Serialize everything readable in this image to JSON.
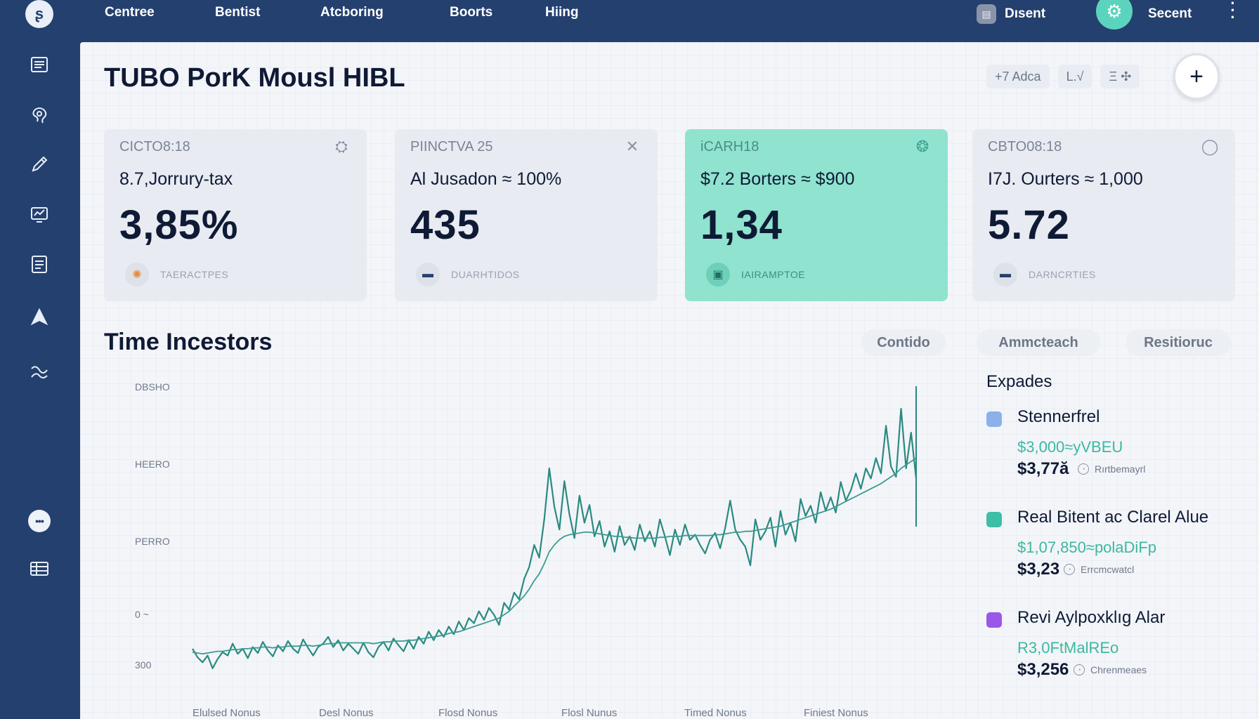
{
  "colors": {
    "nav_bg": "#24406f",
    "accent": "#5cd4bd",
    "chart_line": "#2a8a80",
    "active_card": "#8fe3cf"
  },
  "topbar": {
    "logo_icon": "swirl-logo-icon",
    "nav": [
      "Centree",
      "Bentist",
      "Atcboring",
      "Boorts",
      "Hiing"
    ],
    "doc_label": "Dısent",
    "user_label": "Secent"
  },
  "sidebar": {
    "icons": [
      "list-icon",
      "brain-icon",
      "pencil-icon",
      "monitor-chart-icon",
      "document-icon",
      "paper-plane-icon",
      "exchange-icon",
      "more-dots-icon",
      "grid-list-icon"
    ]
  },
  "page": {
    "title": "TUBO PorK Mousl HIBL",
    "toolbar": [
      "+7 Adca",
      "L.√",
      "Ξ ✣"
    ]
  },
  "kpis": [
    {
      "code": "CICTO8:18",
      "subtitle": "8.7,Jorrury-tax",
      "value": "3,85%",
      "footer": "TAERACTPES",
      "active": false
    },
    {
      "code": "PIINCTVA 25",
      "subtitle": "Al Jusadon ≈ 100%",
      "value": "435",
      "footer": "DUARHTIDOS",
      "active": false
    },
    {
      "code": "iCARH18",
      "subtitle": "$7.2 Borters ≈ $900",
      "value": "1,34",
      "footer": "IAIRAMPTOE",
      "active": true
    },
    {
      "code": "CBTO08:18",
      "subtitle": "I7J. Ourters ≈ 1,000",
      "value": "5.72",
      "footer": "DARNCRTIES",
      "active": false
    }
  ],
  "section": {
    "title": "Time Incestors",
    "pills": [
      "Contido",
      "Ammcteach",
      "Resitioruc"
    ]
  },
  "chart_data": {
    "type": "line",
    "ytick_labels": [
      "DBSHO",
      "HEERO",
      "PERRO",
      "0 ~",
      "300"
    ],
    "xtick_labels": [
      "Elulsed Nonus",
      "Desl Nonus",
      "Flosd Nonus",
      "Flosl Nunus",
      "Timed Nonus",
      "Finiest Nonus"
    ],
    "series": [
      {
        "values": [
          38,
          28,
          22,
          30,
          15,
          26,
          34,
          30,
          44,
          32,
          38,
          27,
          40,
          33,
          46,
          36,
          29,
          42,
          35,
          47,
          38,
          33,
          49,
          39,
          30,
          40,
          44,
          52,
          40,
          48,
          36,
          44,
          38,
          32,
          45,
          34,
          28,
          40,
          46,
          36,
          50,
          42,
          35,
          48,
          38,
          52,
          44,
          58,
          48,
          60,
          52,
          64,
          55,
          70,
          60,
          74,
          68,
          82,
          72,
          86,
          78,
          66,
          92,
          84,
          104,
          96,
          120,
          134,
          160,
          145,
          190,
          250,
          205,
          178,
          235,
          196,
          168,
          218,
          186,
          207,
          170,
          188,
          158,
          176,
          152,
          182,
          160,
          170,
          154,
          184,
          164,
          176,
          158,
          190,
          170,
          148,
          178,
          160,
          184,
          166,
          172,
          160,
          150,
          166,
          174,
          156,
          180,
          212,
          178,
          166,
          158,
          136,
          190,
          166,
          176,
          192,
          158,
          200,
          172,
          186,
          164,
          214,
          194,
          206,
          186,
          222,
          200,
          216,
          198,
          234,
          212,
          224,
          244,
          226,
          250,
          238,
          262,
          244,
          300,
          252,
          240,
          320,
          250,
          292,
          238
        ]
      },
      {
        "values": [
          34,
          33,
          32,
          33,
          34,
          35,
          35,
          36,
          37,
          37,
          38,
          38,
          39,
          39,
          40,
          40,
          39,
          40,
          40,
          41,
          41,
          41,
          42,
          42,
          41,
          42,
          43,
          44,
          44,
          45,
          45,
          45,
          45,
          45,
          45,
          45,
          44,
          45,
          46,
          46,
          47,
          47,
          47,
          48,
          48,
          49,
          50,
          51,
          52,
          53,
          54,
          56,
          57,
          58,
          60,
          62,
          64,
          66,
          68,
          70,
          72,
          74,
          78,
          82,
          88,
          94,
          100,
          108,
          118,
          126,
          138,
          152,
          160,
          166,
          170,
          172,
          173,
          174,
          175,
          175,
          174,
          173,
          172,
          171,
          170,
          170,
          169,
          169,
          168,
          168,
          168,
          168,
          168,
          169,
          169,
          170,
          170,
          170,
          171,
          171,
          171,
          171,
          171,
          171,
          172,
          172,
          173,
          174,
          175,
          175,
          176,
          176,
          177,
          178,
          179,
          180,
          181,
          182,
          184,
          186,
          188,
          190,
          192,
          194,
          196,
          198,
          200,
          202,
          205,
          208,
          211,
          214,
          217,
          220,
          223,
          226,
          229,
          232,
          236,
          240,
          244,
          250,
          254,
          258,
          262
        ]
      }
    ]
  },
  "list": {
    "heading": "Expades",
    "items": [
      {
        "icon": "x-square-icon",
        "icon_color": "#8ab1ea",
        "title": "Stennerfrel",
        "teal": "$3,000≈yVBEU",
        "price": "$3,77ă",
        "meta": "Rırtbemayrl",
        "action": "chevron-right-icon"
      },
      {
        "icon": "stack-icon",
        "icon_color": "#3dbfa7",
        "title": "Real Bitent ac Clarel Alue",
        "teal": "$1,07,850≈polaDiFp",
        "price": "$3,23",
        "meta": "Errcmcwatcl",
        "action": "plus-icon"
      },
      {
        "icon": "app-icon",
        "icon_color": "#9b57e8",
        "title": "Revi Aylpoxklıg Alar",
        "teal": "R3,0FtMalREo",
        "price": "$3,256",
        "meta": "Chrenmeaes",
        "action": "chevron-right-icon"
      }
    ]
  }
}
